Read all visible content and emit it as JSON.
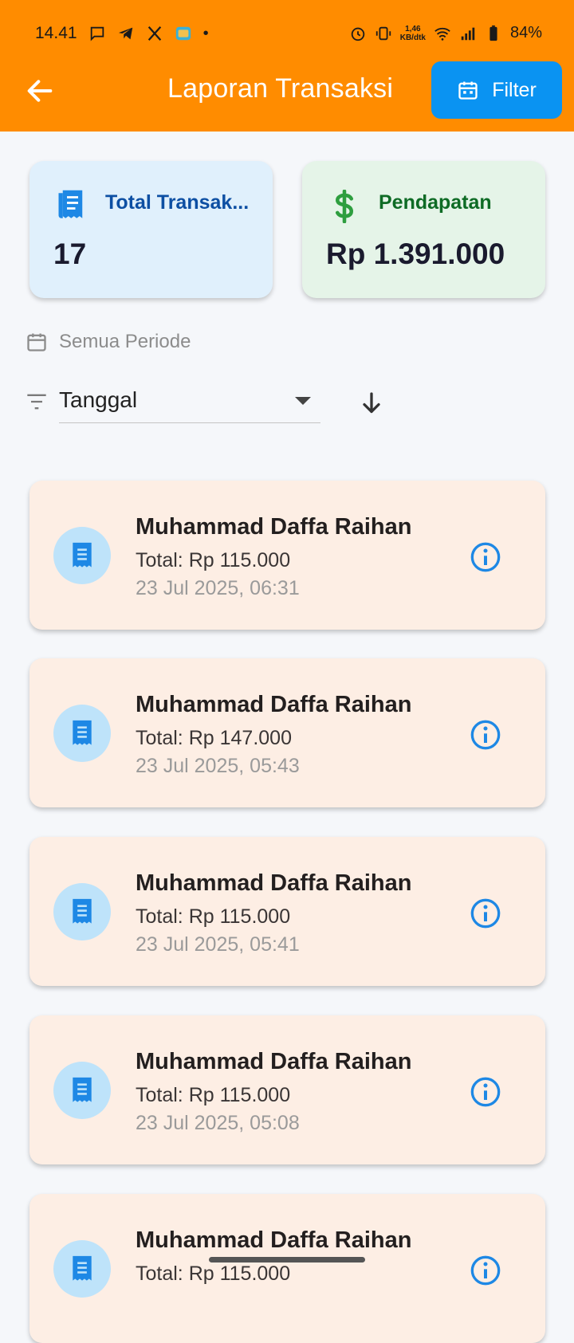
{
  "status_bar": {
    "time": "14.41",
    "speed_top": "1,46",
    "speed_bottom": "KB/dtk",
    "battery": "84%"
  },
  "header": {
    "title": "Laporan Transaksi",
    "filter_label": "Filter"
  },
  "summary": {
    "total_label": "Total Transak...",
    "total_value": "17",
    "income_label": "Pendapatan",
    "income_value": "Rp 1.391.000"
  },
  "period_label": "Semua Periode",
  "sort": {
    "selected": "Tanggal"
  },
  "transactions": [
    {
      "name": "Muhammad Daffa Raihan",
      "total": "Total: Rp 115.000",
      "date": "23 Jul 2025, 06:31"
    },
    {
      "name": "Muhammad Daffa Raihan",
      "total": "Total: Rp 147.000",
      "date": "23 Jul 2025, 05:43"
    },
    {
      "name": "Muhammad Daffa Raihan",
      "total": "Total: Rp 115.000",
      "date": "23 Jul 2025, 05:41"
    },
    {
      "name": "Muhammad Daffa Raihan",
      "total": "Total: Rp 115.000",
      "date": "23 Jul 2025, 05:08"
    },
    {
      "name": "Muhammad Daffa Raihan",
      "total": "Total: Rp 115.000",
      "date": ""
    }
  ],
  "colors": {
    "appbar": "#FF8C00",
    "filter_button": "#0A93F2",
    "total_card": "#E0F0FC",
    "income_card": "#E5F4E8",
    "transaction_card": "#FDEEE4",
    "total_label": "#0D4FA3",
    "income_label": "#0E6B25"
  }
}
